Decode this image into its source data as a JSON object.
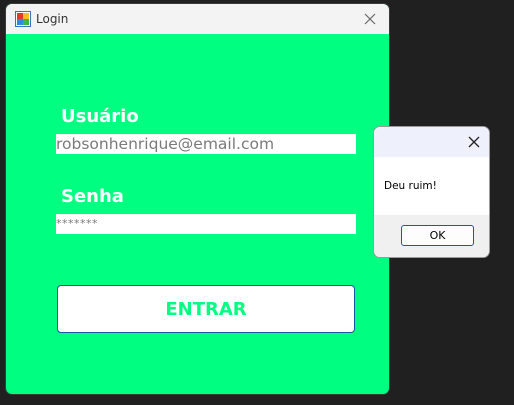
{
  "login_window": {
    "title": "Login",
    "icon": "app-window-icon",
    "close_icon": "close-icon",
    "background_color": "#00ff80",
    "user_label": "Usuário",
    "email_value": "robsonhenrique@email.com",
    "password_label": "Senha",
    "password_value": "*******",
    "enter_button_label": "ENTRAR"
  },
  "dialog": {
    "close_icon": "close-icon",
    "message": "Deu ruim!",
    "ok_label": "OK"
  }
}
